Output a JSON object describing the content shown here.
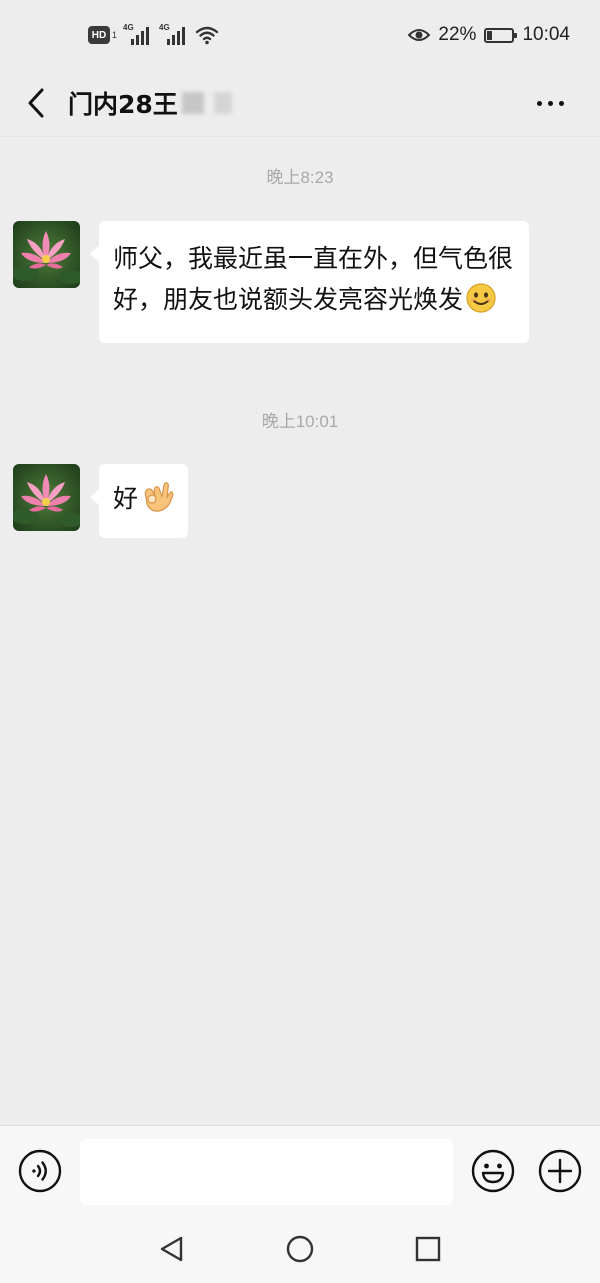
{
  "status_bar": {
    "hd_label": "HD",
    "hd_sub": "1",
    "signal_1_label": "4G",
    "signal_2_label": "4G",
    "battery_percent_text": "22%",
    "battery_level": 0.22,
    "time": "10:04",
    "icons": [
      "hd-icon",
      "signal-icon",
      "signal-icon",
      "wifi-icon",
      "eye-icon",
      "battery-icon"
    ]
  },
  "header": {
    "title": "门内28王",
    "title_partially_obscured": true,
    "back_icon": "chevron-left-icon",
    "more_icon": "more-icon"
  },
  "messages": [
    {
      "timestamp": "晚上8:23",
      "sender": "contact",
      "text": "师父，我最近虽一直在外，但气色很好，朋友也说额头发亮容光焕发",
      "emoji": "smile-emoji"
    },
    {
      "timestamp": "晚上10:01",
      "sender": "contact",
      "text": "好",
      "emoji": "ok-hand-emoji"
    }
  ],
  "input_bar": {
    "value": "",
    "voice_icon": "voice-icon",
    "emoji_icon": "emoji-icon",
    "plus_icon": "plus-icon"
  },
  "system_nav": {
    "icons": [
      "nav-back-icon",
      "nav-home-icon",
      "nav-recent-icon"
    ]
  },
  "colors": {
    "background": "#ededed",
    "bubble": "#ffffff",
    "timestamp": "#a9a9a9",
    "bar": "#f7f7f7",
    "text": "#111111"
  }
}
